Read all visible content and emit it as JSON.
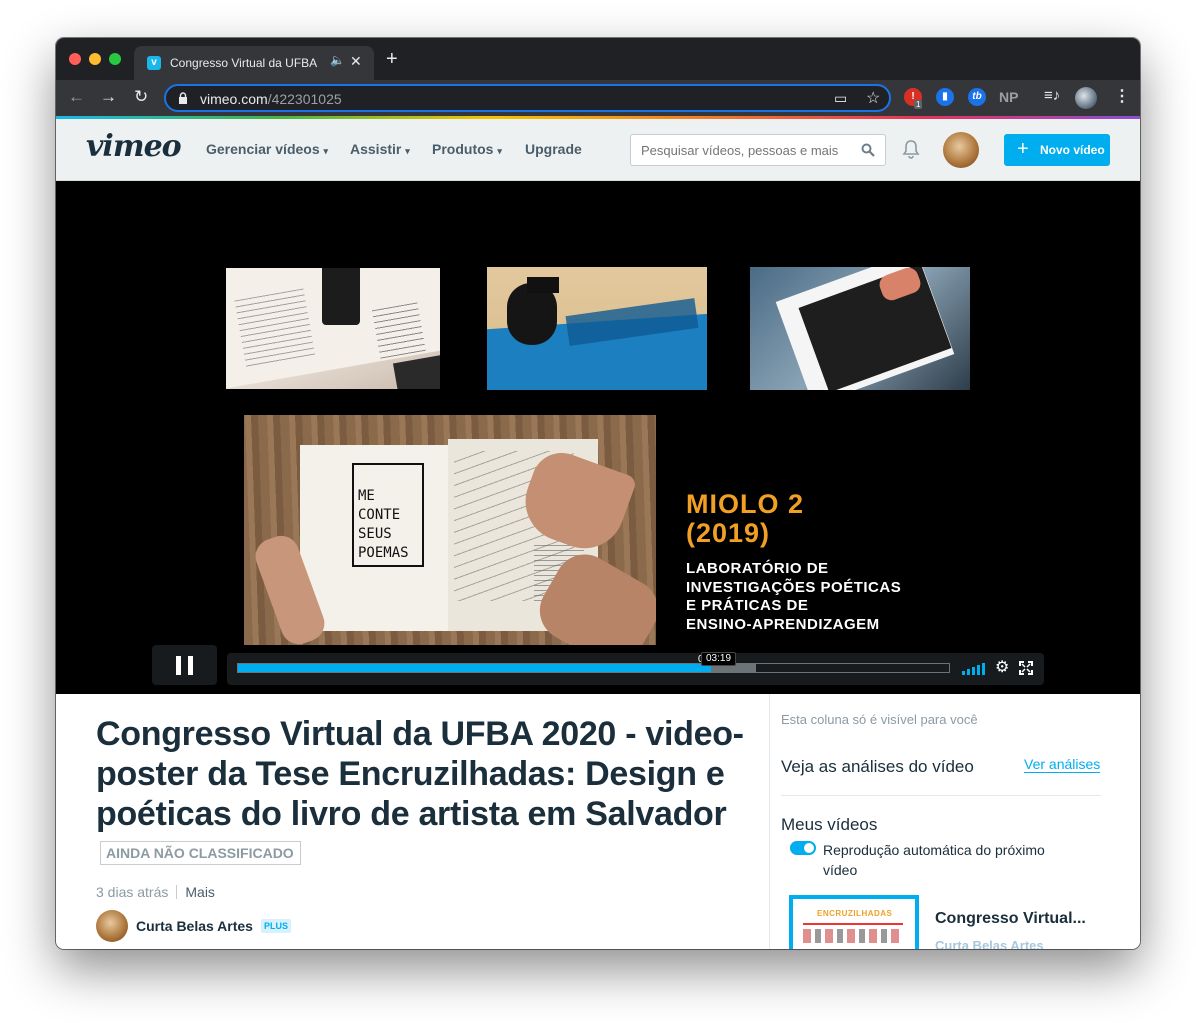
{
  "browser": {
    "tab_title": "Congresso Virtual da UFBA 2020",
    "url_host": "vimeo.com",
    "url_path": "/422301025",
    "ext_badge": "1",
    "ext_np": "NP",
    "new_tab_icon": "plus-icon"
  },
  "header": {
    "logo": "vimeo",
    "nav": [
      "Gerenciar vídeos",
      "Assistir",
      "Produtos",
      "Upgrade"
    ],
    "search_placeholder": "Pesquisar vídeos, pessoas e mais",
    "new_video": "Novo vídeo"
  },
  "player": {
    "overlay_title_line1": "MIOLO 2",
    "overlay_title_line2": "(2019)",
    "overlay_sub_line1": "LABORATÓRIO DE",
    "overlay_sub_line2": "INVESTIGAÇÕES POÉTICAS",
    "overlay_sub_line3": "E PRÁTICAS DE",
    "overlay_sub_line4": "ENSINO-APRENDIZAGEM",
    "book_text": [
      "ME",
      "CONTE",
      "SEUS",
      "POEMAS"
    ],
    "progress_played": 0.665,
    "progress_loaded": 0.728,
    "time_stub": "0",
    "hover_time": "03:19"
  },
  "video": {
    "title": "Congresso Virtual da UFBA 2020 - video-poster da Tese Encruzilhadas: Design e poéticas do livro de artista em Salvador",
    "rating_badge": "AINDA NÃO CLASSIFICADO",
    "age": "3 dias atrás",
    "more": "Mais",
    "author": "Curta Belas Artes",
    "author_badge": "PLUS"
  },
  "sidebar": {
    "note": "Esta coluna só é visível para você",
    "analytics_heading": "Veja as análises do vídeo",
    "analytics_link": "Ver análises",
    "my_videos_heading": "Meus vídeos",
    "autoplay_label": "Reprodução automática do próximo vídeo",
    "autoplay_on": true,
    "card_title": "Congresso Virtual...",
    "card_author": "Curta Belas Artes",
    "card_thumb_text": "ENCRUZILHADAS"
  },
  "colors": {
    "accent": "#00adef",
    "overlay_orange": "#f2a024",
    "heading": "#1a2e3b"
  }
}
